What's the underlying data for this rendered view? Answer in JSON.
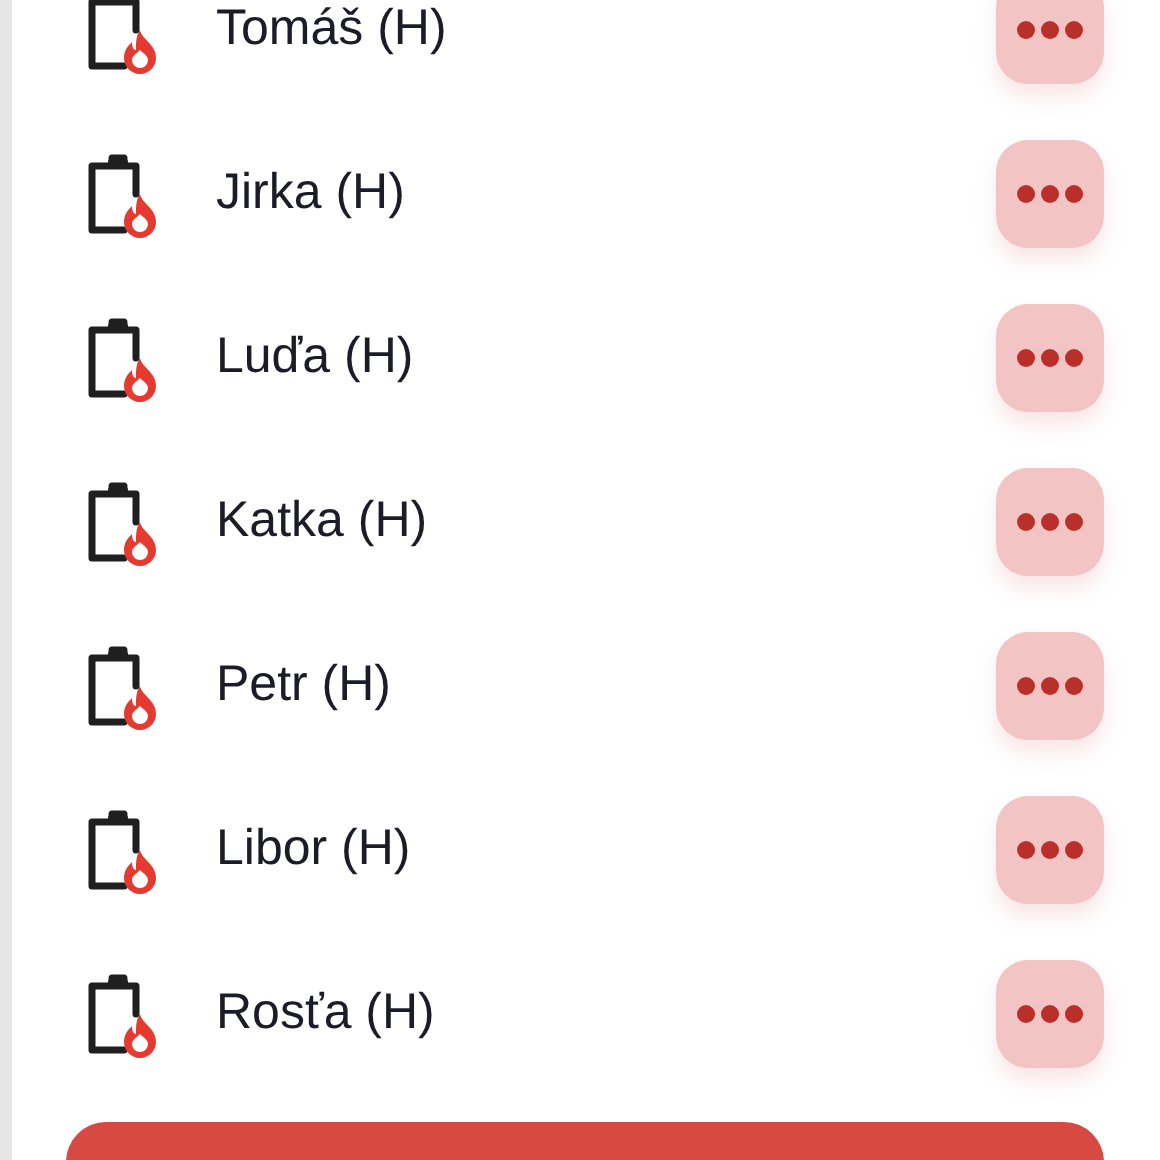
{
  "people": [
    {
      "name": "Tomáš (H)"
    },
    {
      "name": "Jirka (H)"
    },
    {
      "name": "Luďa (H)"
    },
    {
      "name": "Katka (H)"
    },
    {
      "name": "Petr (H)"
    },
    {
      "name": "Libor (H)"
    },
    {
      "name": "Rosťa (H)"
    }
  ],
  "bottom_button": {
    "kind": "primary"
  }
}
